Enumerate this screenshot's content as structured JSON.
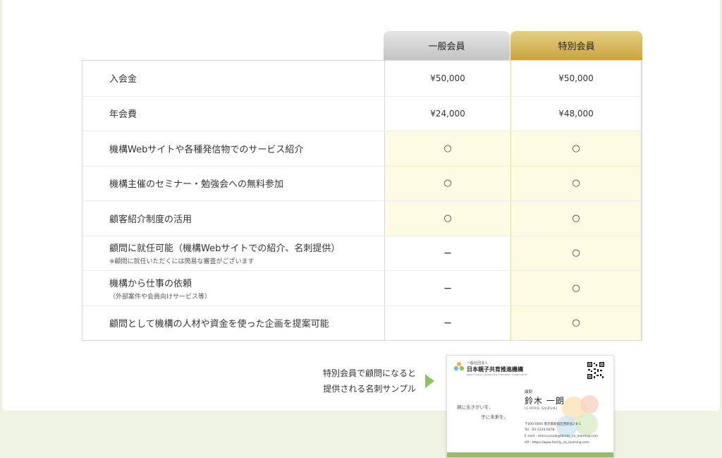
{
  "columns": {
    "general": "一般会員",
    "special": "特別会員"
  },
  "rows": [
    {
      "label": "入会金",
      "note": "",
      "general": "¥50,000",
      "special": "¥50,000"
    },
    {
      "label": "年会費",
      "note": "",
      "general": "¥24,000",
      "special": "¥48,000"
    },
    {
      "label": "機構Webサイトや各種発信物でのサービス紹介",
      "note": "",
      "general": "○",
      "special": "○"
    },
    {
      "label": "機構主催のセミナー・勉強会への無料参加",
      "note": "",
      "general": "○",
      "special": "○"
    },
    {
      "label": "顧客紹介制度の活用",
      "note": "",
      "general": "○",
      "special": "○"
    },
    {
      "label": "顧問に就任可能（機構Webサイトでの紹介、名刺提供）",
      "note": "※顧問に就任いただくには簡易な審査がございます",
      "general": "－",
      "special": "○"
    },
    {
      "label": "機構から仕事の依頼",
      "note": "（外部案件や会員向けサービス等）",
      "general": "－",
      "special": "○"
    },
    {
      "label": "顧問として機構の人材や資金を使った企画を提案可能",
      "note": "",
      "general": "－",
      "special": "○"
    }
  ],
  "sample": {
    "line1": "特別会員で顧問になると",
    "line2": "提供される名刺サンプル"
  },
  "business_card": {
    "org_small": "一般社団法人",
    "org_name": "日本親子共育推進機構",
    "org_en": "Japan Family Co-learning Promotion Organization",
    "role": "顧問",
    "name": "鈴木 一朗",
    "name_en": "ICHIRO SUZUKI",
    "slogan1": "親に生きがいを、",
    "slogan2": "子に未来を。",
    "address": "〒000-0000 東京都新宿区西新宿2-8-1",
    "tel": "Tel : 03-1234-5678",
    "email": "E-mail : ichiro.suzuki@family_co_learning.com",
    "hp": "HP : https://www.family_co_learning.com"
  },
  "colors": {
    "general_header": "#c4c4c4",
    "special_header": "#c9a440",
    "highlight": "#fdfbe3",
    "accent_green": "#93c162"
  }
}
